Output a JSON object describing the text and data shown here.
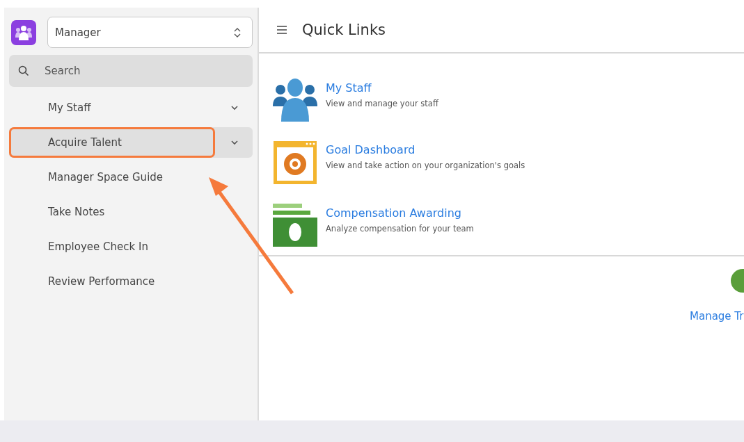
{
  "sidebar": {
    "role_select": {
      "value": "Manager"
    },
    "search": {
      "placeholder": "Search"
    },
    "items": [
      {
        "label": "My Staff",
        "expandable": true,
        "selected": false,
        "highlighted": false
      },
      {
        "label": "Acquire Talent",
        "expandable": true,
        "selected": true,
        "highlighted": true
      },
      {
        "label": "Manager Space Guide",
        "expandable": false,
        "selected": false,
        "highlighted": false
      },
      {
        "label": "Take Notes",
        "expandable": false,
        "selected": false,
        "highlighted": false
      },
      {
        "label": "Employee Check In",
        "expandable": false,
        "selected": false,
        "highlighted": false
      },
      {
        "label": "Review Performance",
        "expandable": false,
        "selected": false,
        "highlighted": false
      }
    ]
  },
  "main": {
    "title": "Quick Links",
    "links": [
      {
        "kind": "staff",
        "title": "My Staff",
        "description": "View and manage your staff"
      },
      {
        "kind": "goals",
        "title": "Goal Dashboard",
        "description": "View and take action on your organization's goals"
      },
      {
        "kind": "compensation",
        "title": "Compensation Awarding",
        "description": "Analyze compensation for your team"
      }
    ],
    "secondary_link": "Manage Tr"
  }
}
